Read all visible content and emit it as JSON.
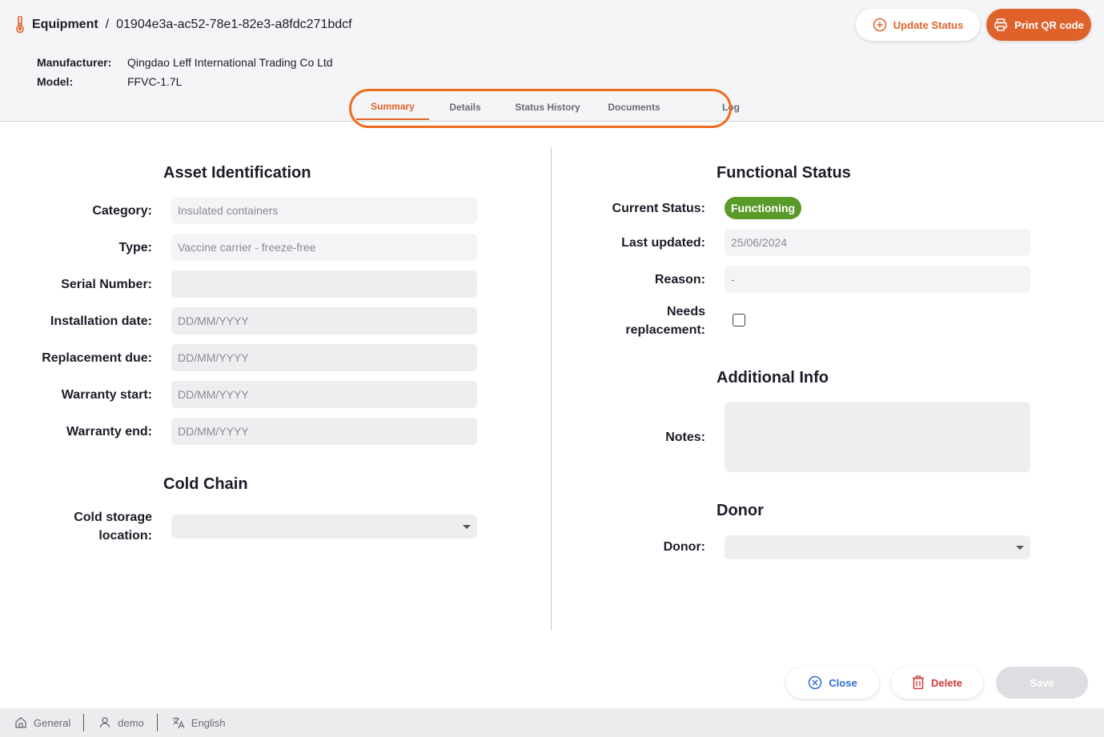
{
  "header": {
    "breadcrumb_root": "Equipment",
    "breadcrumb_sep": "/",
    "asset_id": "01904e3a-ac52-78e1-82e3-a8fdc271bdcf",
    "manufacturer_label": "Manufacturer:",
    "manufacturer_value": "Qingdao Leff International Trading Co Ltd",
    "model_label": "Model:",
    "model_value": "FFVC-1.7L",
    "update_status_label": "Update Status",
    "print_qr_label": "Print QR code",
    "accent_color": "#e0622b"
  },
  "tabs": [
    {
      "label": "Summary",
      "active": true
    },
    {
      "label": "Details",
      "active": false
    },
    {
      "label": "Status History",
      "active": false
    },
    {
      "label": "Documents",
      "active": false
    },
    {
      "label": "Log",
      "active": false
    }
  ],
  "asset_identification": {
    "title": "Asset Identification",
    "category_label": "Category:",
    "category_value": "Insulated containers",
    "type_label": "Type:",
    "type_value": "Vaccine carrier - freeze-free",
    "serial_label": "Serial Number:",
    "serial_value": "",
    "installation_label": "Installation date:",
    "installation_placeholder": "DD/MM/YYYY",
    "replacement_label": "Replacement due:",
    "replacement_placeholder": "DD/MM/YYYY",
    "warranty_start_label": "Warranty start:",
    "warranty_start_placeholder": "DD/MM/YYYY",
    "warranty_end_label": "Warranty end:",
    "warranty_end_placeholder": "DD/MM/YYYY"
  },
  "cold_chain": {
    "title": "Cold Chain",
    "location_label_1": "Cold storage",
    "location_label_2": "location:",
    "location_value": ""
  },
  "functional_status": {
    "title": "Functional Status",
    "current_label": "Current Status:",
    "current_value": "Functioning",
    "current_color": "#5a9a2a",
    "last_updated_label": "Last updated:",
    "last_updated_value": "25/06/2024",
    "reason_label": "Reason:",
    "reason_value": "-",
    "needs_label_1": "Needs",
    "needs_label_2": "replacement:",
    "needs_checked": false
  },
  "additional_info": {
    "title": "Additional Info",
    "notes_label": "Notes:",
    "notes_value": ""
  },
  "donor": {
    "title": "Donor",
    "donor_label": "Donor:",
    "donor_value": ""
  },
  "footer": {
    "close_label": "Close",
    "delete_label": "Delete",
    "save_label": "Save"
  },
  "statusbar": {
    "store": "General",
    "user": "demo",
    "language": "English"
  },
  "highlight_color": "#ef6c1f"
}
